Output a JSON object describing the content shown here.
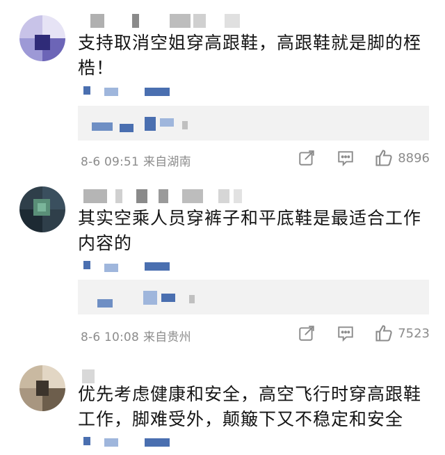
{
  "comments": [
    {
      "text": "支持取消空姐穿高跟鞋，高跟鞋就是脚的桎梏！",
      "time": "8-6 09:51",
      "location": "来自湖南",
      "likes": "8896",
      "avatar_colors": [
        "#c8c3e8",
        "#6c65b7",
        "#2f2b78",
        "#9d99d6",
        "#e6e3f5"
      ]
    },
    {
      "text": "其实空乘人员穿裤子和平底鞋是最适合工作内容的",
      "time": "8-6 10:08",
      "location": "来自贵州",
      "likes": "7523",
      "avatar_colors": [
        "#2f3f4a",
        "#5a8f78",
        "#1d2a33",
        "#7ab59a",
        "#3a4f5e"
      ]
    },
    {
      "text": "优先考虑健康和安全，高空飞行时穿高跟鞋工作，脚难受外，颠簸下又不稳定和安全",
      "avatar_colors": [
        "#c9b9a1",
        "#6d5e4c",
        "#e2d6c4",
        "#3c342c",
        "#a89680"
      ]
    }
  ],
  "icons": {
    "share": "share-icon",
    "comment": "comment-icon",
    "like": "thumbs-up-icon"
  },
  "blur_colors": {
    "dark": "#9c9c9c",
    "blue": "#4a6fb0",
    "light_blue": "#9fb6dc"
  }
}
